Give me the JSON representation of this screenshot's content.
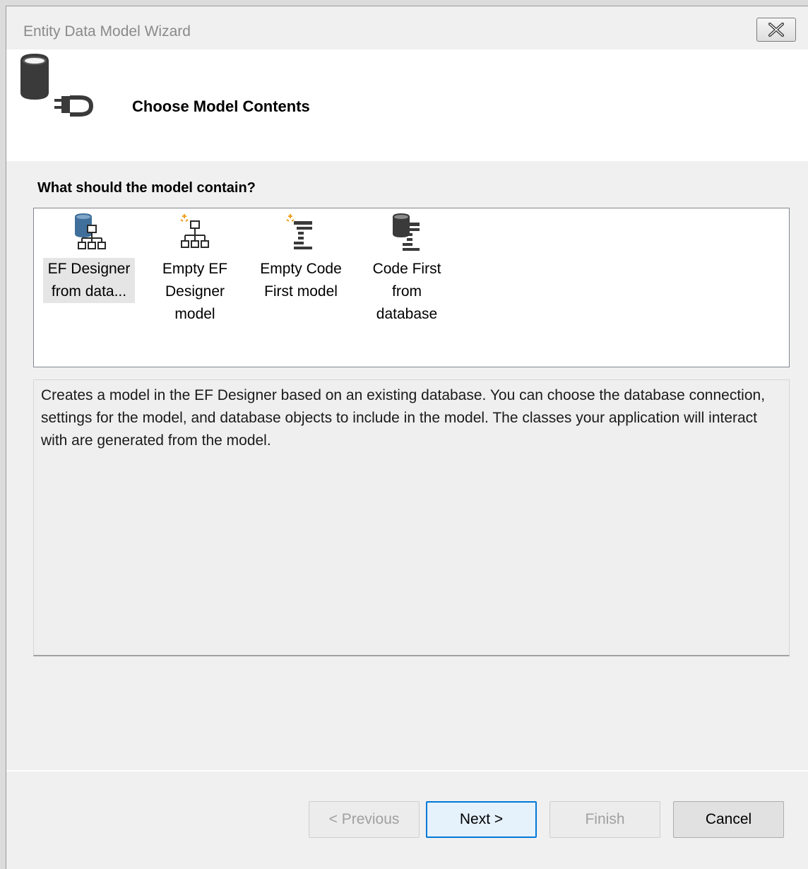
{
  "window": {
    "title": "Entity Data Model Wizard"
  },
  "header": {
    "title": "Choose Model Contents",
    "icon": "database-plug-icon"
  },
  "question": "What should the model contain?",
  "options": [
    {
      "label": "EF Designer from data...",
      "icon": "ef-designer-database-icon",
      "selected": true
    },
    {
      "label": "Empty EF Designer model",
      "icon": "empty-ef-designer-icon",
      "selected": false
    },
    {
      "label": "Empty Code First model",
      "icon": "empty-code-first-icon",
      "selected": false
    },
    {
      "label": "Code First from database",
      "icon": "code-first-database-icon",
      "selected": false
    }
  ],
  "description": "Creates a model in the EF Designer based on an existing database. You can choose the database connection, settings for the model, and database objects to include in the model. The classes your application will interact with are generated from the model.",
  "buttons": {
    "previous": "< Previous",
    "next": "Next >",
    "finish": "Finish",
    "cancel": "Cancel"
  },
  "colors": {
    "accent": "#0078d7",
    "selected_icon": "#4a7fb0",
    "spark": "#f0a020"
  }
}
